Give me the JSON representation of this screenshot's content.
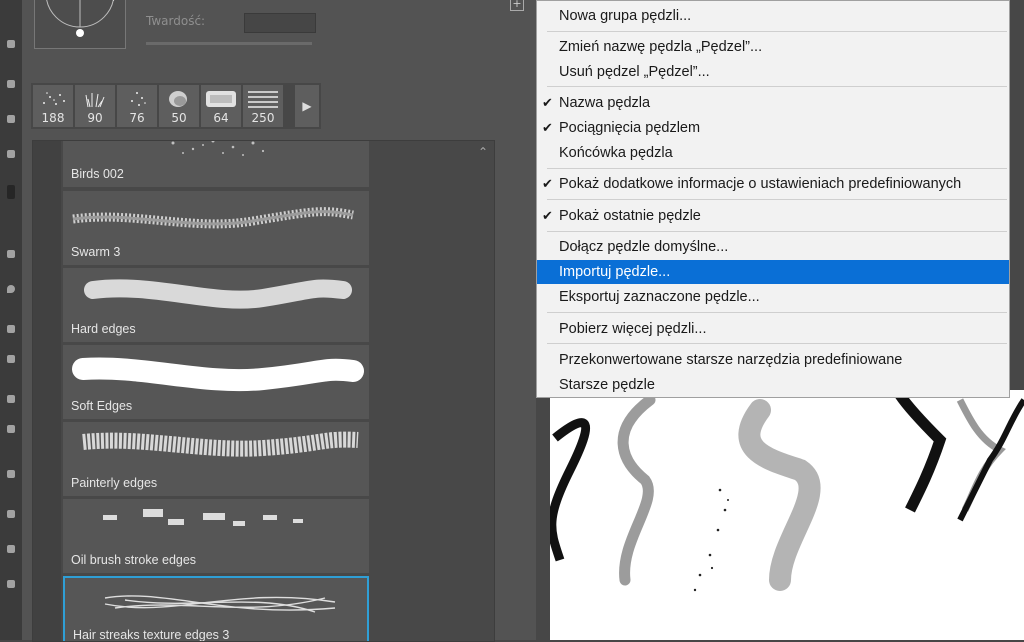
{
  "brush_settings": {
    "hardness_label": "Twardość:"
  },
  "recent_brushes": [
    {
      "size": "188"
    },
    {
      "size": "90"
    },
    {
      "size": "76"
    },
    {
      "size": "50"
    },
    {
      "size": "64"
    },
    {
      "size": "250"
    }
  ],
  "brush_list": [
    {
      "name": "Birds 002"
    },
    {
      "name": "Swarm 3"
    },
    {
      "name": "Hard edges"
    },
    {
      "name": "Soft Edges"
    },
    {
      "name": "Painterly edges"
    },
    {
      "name": "Oil brush stroke edges"
    },
    {
      "name": "Hair streaks texture edges 3"
    }
  ],
  "context_menu": {
    "items": [
      {
        "label": "Nowa grupa pędzli...",
        "checked": false
      },
      {
        "label": "Zmień nazwę pędzla „Pędzel”...",
        "checked": false
      },
      {
        "label": "Usuń pędzel „Pędzel”...",
        "checked": false
      },
      {
        "label": "Nazwa pędzla",
        "checked": true
      },
      {
        "label": "Pociągnięcia pędzlem",
        "checked": true
      },
      {
        "label": "Końcówka pędzla",
        "checked": false
      },
      {
        "label": "Pokaż dodatkowe informacje o ustawieniach predefiniowanych",
        "checked": true
      },
      {
        "label": "Pokaż ostatnie pędzle",
        "checked": true
      },
      {
        "label": "Dołącz pędzle domyślne...",
        "checked": false
      },
      {
        "label": "Importuj pędzle...",
        "checked": false,
        "highlighted": true
      },
      {
        "label": "Eksportuj zaznaczone pędzle...",
        "checked": false
      },
      {
        "label": "Pobierz więcej pędzli...",
        "checked": false
      },
      {
        "label": "Przekonwertowane starsze narzędzia predefiniowane",
        "checked": false
      },
      {
        "label": "Starsze pędzle",
        "checked": false
      }
    ],
    "check_glyph": "✔"
  },
  "colors": {
    "highlight": "#0a6fd6",
    "selection_border": "#2f9fd6",
    "panel_bg": "#535353"
  }
}
